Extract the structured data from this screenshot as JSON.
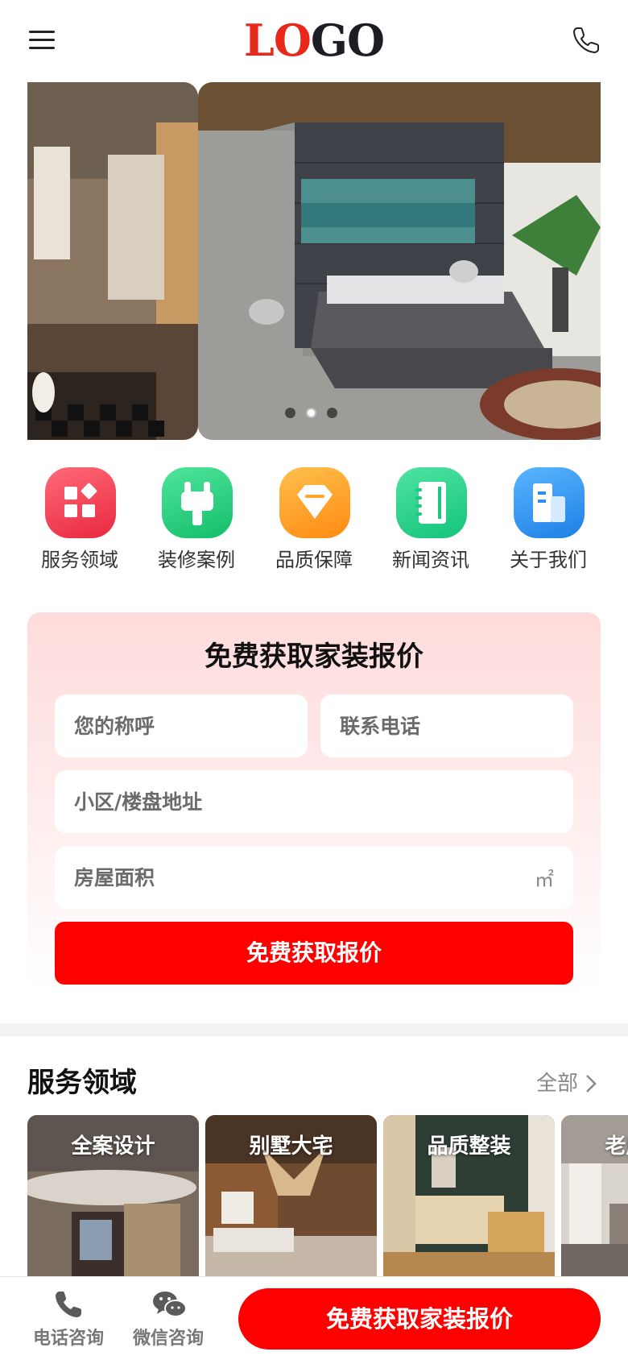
{
  "header": {
    "logo_part1": "LO",
    "logo_part2": "GO"
  },
  "banner": {
    "slide_count": 3,
    "active_slide": 2
  },
  "quick_nav": [
    {
      "label": "服务领域",
      "icon": "grid-icon",
      "color": "#f0435a"
    },
    {
      "label": "装修案例",
      "icon": "plug-icon",
      "color": "#1fcf7a"
    },
    {
      "label": "品质保障",
      "icon": "diamond-icon",
      "color": "#ff9b22"
    },
    {
      "label": "新闻资讯",
      "icon": "notebook-icon",
      "color": "#22cf88"
    },
    {
      "label": "关于我们",
      "icon": "building-icon",
      "color": "#2f8ff0"
    }
  ],
  "quote_form": {
    "title": "免费获取家装报价",
    "name_placeholder": "您的称呼",
    "phone_placeholder": "联系电话",
    "address_placeholder": "小区/楼盘地址",
    "area_placeholder": "房屋面积",
    "area_unit": "㎡",
    "submit_label": "免费获取报价"
  },
  "services": {
    "title": "服务领域",
    "more_label": "全部",
    "cards": [
      {
        "label": "全案设计"
      },
      {
        "label": "别墅大宅"
      },
      {
        "label": "品质整装"
      },
      {
        "label": "老房翻新"
      }
    ]
  },
  "bottom_bar": {
    "phone_label": "电话咨询",
    "wechat_label": "微信咨询",
    "cta_label": "免费获取家装报价"
  },
  "colors": {
    "primary_red": "#ff0000",
    "logo_red": "#e8281a",
    "logo_dark": "#1d1d24"
  }
}
